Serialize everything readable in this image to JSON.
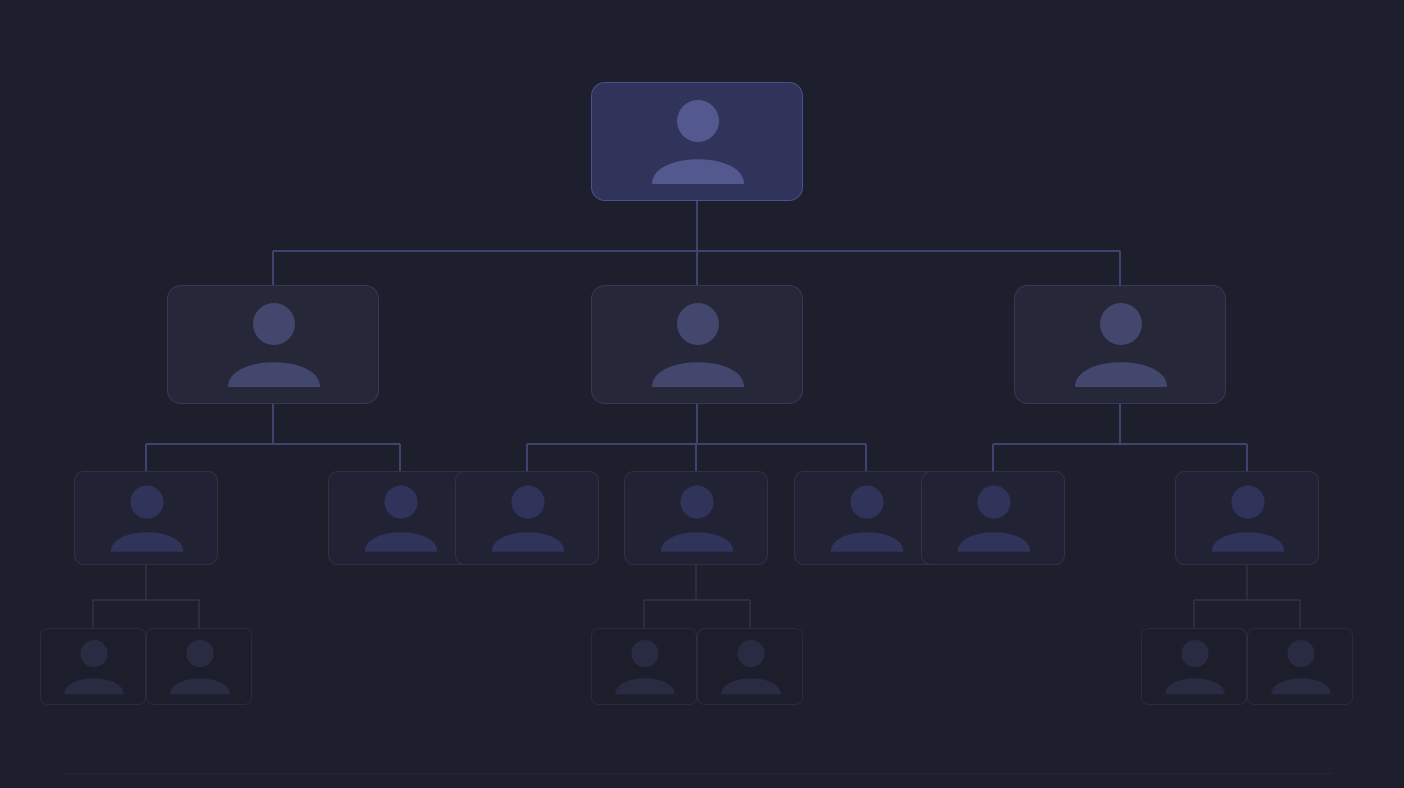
{
  "diagram": {
    "type": "org-chart",
    "avatar_icon": "person-silhouette-icon",
    "palette": {
      "background": "#1e1f2d",
      "root": {
        "fill": "#30345a",
        "stroke": "#4a5190",
        "avatar": "#53598f"
      },
      "manager": {
        "fill": "#262839",
        "stroke": "#363956",
        "avatar": "#44476d"
      },
      "team_member": {
        "fill": "#212233",
        "stroke": "#2f3149",
        "avatar": "#30335a"
      },
      "junior": {
        "fill": "#1d1e2c",
        "stroke": "#2a2c3e",
        "avatar": "#292b43"
      },
      "connector_strong": "#3e4370",
      "connector_faint": "#34374f",
      "footer_rule": "#25273a"
    },
    "nodes": [
      {
        "id": "root",
        "level": 0,
        "parent": null
      },
      {
        "id": "m1",
        "level": 1,
        "parent": "root"
      },
      {
        "id": "m2",
        "level": 1,
        "parent": "root"
      },
      {
        "id": "m3",
        "level": 1,
        "parent": "root"
      },
      {
        "id": "t1",
        "level": 2,
        "parent": "m1"
      },
      {
        "id": "t2",
        "level": 2,
        "parent": "m1"
      },
      {
        "id": "t3",
        "level": 2,
        "parent": "m2"
      },
      {
        "id": "t4",
        "level": 2,
        "parent": "m2"
      },
      {
        "id": "t5",
        "level": 2,
        "parent": "m2"
      },
      {
        "id": "t6",
        "level": 2,
        "parent": "m3"
      },
      {
        "id": "t7",
        "level": 2,
        "parent": "m3"
      },
      {
        "id": "j1",
        "level": 3,
        "parent": "t1"
      },
      {
        "id": "j2",
        "level": 3,
        "parent": "t1"
      },
      {
        "id": "j3",
        "level": 3,
        "parent": "t4"
      },
      {
        "id": "j4",
        "level": 3,
        "parent": "t4"
      },
      {
        "id": "j5",
        "level": 3,
        "parent": "t7"
      },
      {
        "id": "j6",
        "level": 3,
        "parent": "t7"
      }
    ]
  }
}
